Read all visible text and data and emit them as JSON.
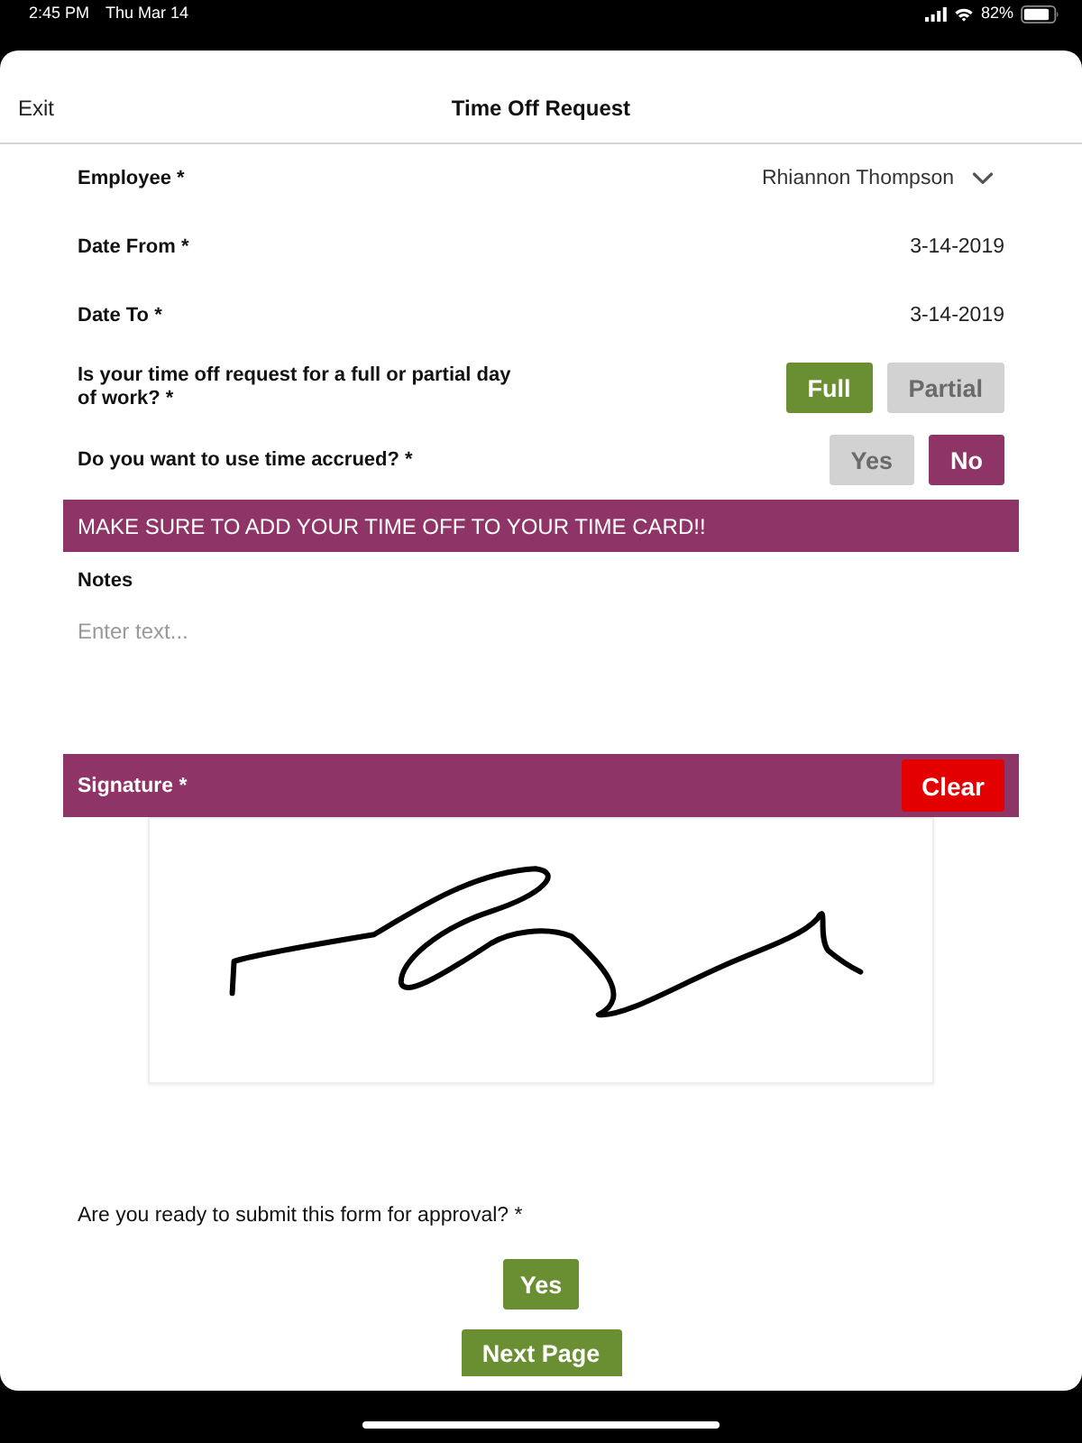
{
  "status_bar": {
    "time": "2:45 PM",
    "date": "Thu Mar 14",
    "battery": "82%"
  },
  "nav_bar": {
    "left_action": "Exit",
    "title": "Time Off Request"
  },
  "fields": [
    {
      "kind": "select",
      "label": "Employee *",
      "value": "Rhiannon Thompson"
    },
    {
      "kind": "value",
      "label": "Date From *",
      "value": "3-14-2019"
    },
    {
      "kind": "value",
      "label": "Date To *",
      "value": "3-14-2019"
    },
    {
      "kind": "choice",
      "label": "Is your time off request for a full or partial day of work? *",
      "color": "#6a8f33",
      "options": [
        {
          "label": "Full",
          "selected": true
        },
        {
          "label": "Partial",
          "selected": false
        }
      ]
    },
    {
      "kind": "choice",
      "label": "Do you want to use time accrued? *",
      "color": "#8e3466",
      "options": [
        {
          "label": "Yes",
          "selected": false
        },
        {
          "label": "No",
          "selected": true
        }
      ]
    }
  ],
  "banner": {
    "text": "MAKE SURE TO ADD YOUR TIME OFF TO YOUR TIME CARD!!"
  },
  "notes": {
    "label": "Notes",
    "placeholder": "Enter text..."
  },
  "signature": {
    "label": "Signature *",
    "clear_button": "Clear"
  },
  "submit": {
    "question": "Are you ready to submit this form for approval? *",
    "color": "#6a8f33",
    "options": [
      {
        "label": "Yes",
        "selected": true
      }
    ]
  },
  "next_button": "Next Page"
}
